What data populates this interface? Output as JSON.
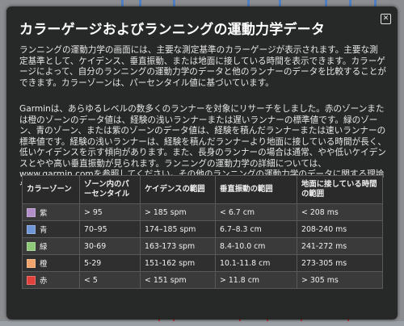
{
  "dialog": {
    "title": "カラーゲージおよびランニングの運動力学データ",
    "paragraph1": "ランニングの運動力学の画面には、主要な測定基準のカラーゲージが表示されます。主要な測定基準として、ケイデンス、垂直振動、または地面に接している時間を表示できます。カラーゲージによって、自分のランニングの運動力学のデータと他のランナーのデータを比較することができます。カラーゾーンは、パーセンタイル値に基づいています。",
    "paragraph2": "Garminは、あらゆるレベルの数多くのランナーを対象にリサーチをしました。赤のゾーンまたは橙のゾーンのデータ値は、経験の浅いランナーまたは遅いランナーの標準値です。緑のゾーン、青のゾーン、または紫のゾーンのデータ値は、経験を積んだランナーまたは速いランナーの標準値です。経験の浅いランナーは、経験を積んだランナーより地面に接している時間が長く、低いケイデンスを示す傾向があります。また、長身のランナーの場合は通常、やや低いケイデンスとやや高い垂直振動が見られます。ランニングの運動力学の詳細については、www.garmin.comを参照してください。その他のランニングの運動力学のデータに関する理論や解釈については、信頼できるランニング関連出版物およびウェブサイトをご覧ください。",
    "close_icon": "close-icon"
  },
  "table": {
    "headers": [
      "カラーゾーン",
      "ゾーン内のパーセンタイル",
      "ケイデンスの範囲",
      "垂直振動の範囲",
      "地面に接している時間の範囲"
    ],
    "rows": [
      {
        "zone": "紫",
        "color": "#b28fc9",
        "percentile": "> 95",
        "cadence": "> 185 spm",
        "vertical": "< 6.7 cm",
        "contact": "< 208 ms"
      },
      {
        "zone": "青",
        "color": "#6f96d6",
        "percentile": "70–95",
        "cadence": "174–185 spm",
        "vertical": "6.7–8.3 cm",
        "contact": "208-240 ms"
      },
      {
        "zone": "緑",
        "color": "#8fc97a",
        "percentile": "30-69",
        "cadence": "163-173 spm",
        "vertical": "8.4-10.0 cm",
        "contact": "241-272 ms"
      },
      {
        "zone": "橙",
        "color": "#f0a36b",
        "percentile": "5-29",
        "cadence": "151-162 spm",
        "vertical": "10.1-11.8 cm",
        "contact": "273-305 ms"
      },
      {
        "zone": "赤",
        "color": "#e2403a",
        "percentile": "< 5",
        "cadence": "< 151 spm",
        "vertical": "> 11.8 cm",
        "contact": "> 305 ms"
      }
    ]
  }
}
